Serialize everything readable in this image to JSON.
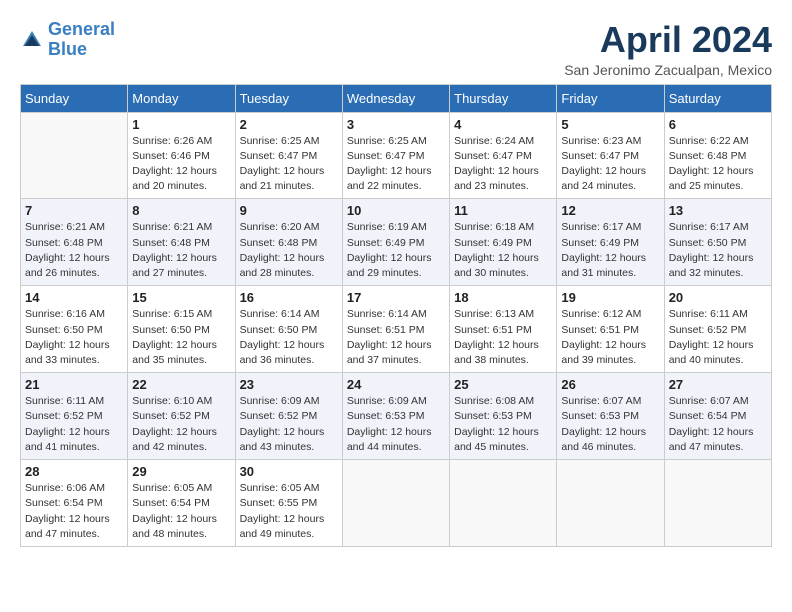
{
  "logo": {
    "line1": "General",
    "line2": "Blue"
  },
  "title": "April 2024",
  "location": "San Jeronimo Zacualpan, Mexico",
  "days_of_week": [
    "Sunday",
    "Monday",
    "Tuesday",
    "Wednesday",
    "Thursday",
    "Friday",
    "Saturday"
  ],
  "weeks": [
    [
      {
        "day": "",
        "empty": true
      },
      {
        "day": "1",
        "sunrise": "6:26 AM",
        "sunset": "6:46 PM",
        "daylight": "12 hours and 20 minutes."
      },
      {
        "day": "2",
        "sunrise": "6:25 AM",
        "sunset": "6:47 PM",
        "daylight": "12 hours and 21 minutes."
      },
      {
        "day": "3",
        "sunrise": "6:25 AM",
        "sunset": "6:47 PM",
        "daylight": "12 hours and 22 minutes."
      },
      {
        "day": "4",
        "sunrise": "6:24 AM",
        "sunset": "6:47 PM",
        "daylight": "12 hours and 23 minutes."
      },
      {
        "day": "5",
        "sunrise": "6:23 AM",
        "sunset": "6:47 PM",
        "daylight": "12 hours and 24 minutes."
      },
      {
        "day": "6",
        "sunrise": "6:22 AM",
        "sunset": "6:48 PM",
        "daylight": "12 hours and 25 minutes."
      }
    ],
    [
      {
        "day": "7",
        "sunrise": "6:21 AM",
        "sunset": "6:48 PM",
        "daylight": "12 hours and 26 minutes."
      },
      {
        "day": "8",
        "sunrise": "6:21 AM",
        "sunset": "6:48 PM",
        "daylight": "12 hours and 27 minutes."
      },
      {
        "day": "9",
        "sunrise": "6:20 AM",
        "sunset": "6:48 PM",
        "daylight": "12 hours and 28 minutes."
      },
      {
        "day": "10",
        "sunrise": "6:19 AM",
        "sunset": "6:49 PM",
        "daylight": "12 hours and 29 minutes."
      },
      {
        "day": "11",
        "sunrise": "6:18 AM",
        "sunset": "6:49 PM",
        "daylight": "12 hours and 30 minutes."
      },
      {
        "day": "12",
        "sunrise": "6:17 AM",
        "sunset": "6:49 PM",
        "daylight": "12 hours and 31 minutes."
      },
      {
        "day": "13",
        "sunrise": "6:17 AM",
        "sunset": "6:50 PM",
        "daylight": "12 hours and 32 minutes."
      }
    ],
    [
      {
        "day": "14",
        "sunrise": "6:16 AM",
        "sunset": "6:50 PM",
        "daylight": "12 hours and 33 minutes."
      },
      {
        "day": "15",
        "sunrise": "6:15 AM",
        "sunset": "6:50 PM",
        "daylight": "12 hours and 35 minutes."
      },
      {
        "day": "16",
        "sunrise": "6:14 AM",
        "sunset": "6:50 PM",
        "daylight": "12 hours and 36 minutes."
      },
      {
        "day": "17",
        "sunrise": "6:14 AM",
        "sunset": "6:51 PM",
        "daylight": "12 hours and 37 minutes."
      },
      {
        "day": "18",
        "sunrise": "6:13 AM",
        "sunset": "6:51 PM",
        "daylight": "12 hours and 38 minutes."
      },
      {
        "day": "19",
        "sunrise": "6:12 AM",
        "sunset": "6:51 PM",
        "daylight": "12 hours and 39 minutes."
      },
      {
        "day": "20",
        "sunrise": "6:11 AM",
        "sunset": "6:52 PM",
        "daylight": "12 hours and 40 minutes."
      }
    ],
    [
      {
        "day": "21",
        "sunrise": "6:11 AM",
        "sunset": "6:52 PM",
        "daylight": "12 hours and 41 minutes."
      },
      {
        "day": "22",
        "sunrise": "6:10 AM",
        "sunset": "6:52 PM",
        "daylight": "12 hours and 42 minutes."
      },
      {
        "day": "23",
        "sunrise": "6:09 AM",
        "sunset": "6:52 PM",
        "daylight": "12 hours and 43 minutes."
      },
      {
        "day": "24",
        "sunrise": "6:09 AM",
        "sunset": "6:53 PM",
        "daylight": "12 hours and 44 minutes."
      },
      {
        "day": "25",
        "sunrise": "6:08 AM",
        "sunset": "6:53 PM",
        "daylight": "12 hours and 45 minutes."
      },
      {
        "day": "26",
        "sunrise": "6:07 AM",
        "sunset": "6:53 PM",
        "daylight": "12 hours and 46 minutes."
      },
      {
        "day": "27",
        "sunrise": "6:07 AM",
        "sunset": "6:54 PM",
        "daylight": "12 hours and 47 minutes."
      }
    ],
    [
      {
        "day": "28",
        "sunrise": "6:06 AM",
        "sunset": "6:54 PM",
        "daylight": "12 hours and 47 minutes."
      },
      {
        "day": "29",
        "sunrise": "6:05 AM",
        "sunset": "6:54 PM",
        "daylight": "12 hours and 48 minutes."
      },
      {
        "day": "30",
        "sunrise": "6:05 AM",
        "sunset": "6:55 PM",
        "daylight": "12 hours and 49 minutes."
      },
      {
        "day": "",
        "empty": true
      },
      {
        "day": "",
        "empty": true
      },
      {
        "day": "",
        "empty": true
      },
      {
        "day": "",
        "empty": true
      }
    ]
  ],
  "labels": {
    "sunrise": "Sunrise:",
    "sunset": "Sunset:",
    "daylight": "Daylight:"
  }
}
